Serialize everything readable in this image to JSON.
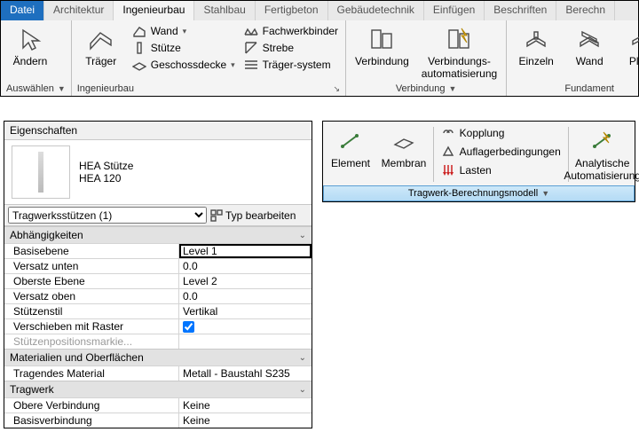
{
  "tabs": {
    "file": "Datei",
    "arch": "Architektur",
    "ing": "Ingenieurbau",
    "stahl": "Stahlbau",
    "fertig": "Fertigbeton",
    "geb": "Gebäudetechnik",
    "einf": "Einfügen",
    "beschr": "Beschriften",
    "berechn": "Berechn"
  },
  "ribbon": {
    "auswaehlen": {
      "aendern": "Ändern",
      "title": "Auswählen"
    },
    "ing": {
      "traeger": "Träger",
      "wand": "Wand",
      "stuetze": "Stütze",
      "geschoss": "Geschossdecke",
      "fachwerk": "Fachwerkbinder",
      "strebe": "Strebe",
      "tsystem": "Träger-system",
      "title": "Ingenieurbau"
    },
    "verb": {
      "verbindung": "Verbindung",
      "auto": "Verbindungs-\nautomatisierung",
      "title": "Verbindung"
    },
    "fund": {
      "einzeln": "Einzeln",
      "wand": "Wand",
      "platte": "Platte",
      "title": "Fundament"
    }
  },
  "props": {
    "title": "Eigenschaften",
    "family": "HEA Stütze",
    "type": "HEA 120",
    "selector": "Tragwerksstützen (1)",
    "typedit": "Typ bearbeiten",
    "groups": {
      "abh": "Abhängigkeiten",
      "mat": "Materialien und Oberflächen",
      "trag": "Tragwerk"
    },
    "rows": {
      "basisebene": {
        "l": "Basisebene",
        "v": "Level 1"
      },
      "vu": {
        "l": "Versatz unten",
        "v": "0.0"
      },
      "oe": {
        "l": "Oberste Ebene",
        "v": "Level 2"
      },
      "vo": {
        "l": "Versatz oben",
        "v": "0.0"
      },
      "stil": {
        "l": "Stützenstil",
        "v": "Vertikal"
      },
      "verschieben": {
        "l": "Verschieben mit Raster"
      },
      "spm": {
        "l": "Stützenpositionsmarkie..."
      },
      "material": {
        "l": "Tragendes Material",
        "v": "Metall - Baustahl S235"
      },
      "ov": {
        "l": "Obere Verbindung",
        "v": "Keine"
      },
      "bv": {
        "l": "Basisverbindung",
        "v": "Keine"
      }
    }
  },
  "panel2": {
    "element": "Element",
    "membran": "Membran",
    "kopplung": "Kopplung",
    "auflager": "Auflagerbedingungen",
    "lasten": "Lasten",
    "auto": "Analytische\nAutomatisierung",
    "title": "Tragwerk-Berechnungsmodell"
  }
}
